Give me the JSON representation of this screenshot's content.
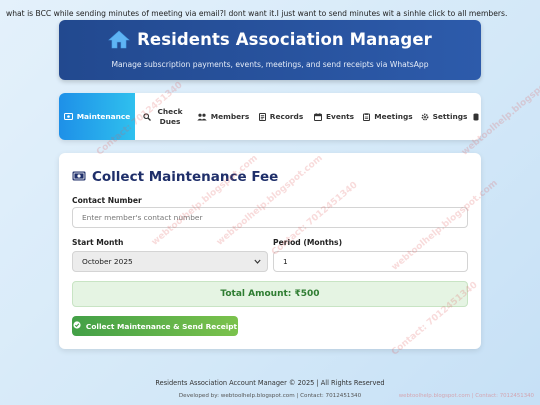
{
  "top_note": "what is BCC while sending minutes of meeting via email?I dont want it.I just want to send minutes wit a sinhle click to all members.",
  "header": {
    "title": "Residents Association Manager",
    "subtitle": "Manage subscription payments, events, meetings, and send receipts via WhatsApp",
    "icon": "home-icon"
  },
  "nav": {
    "tabs": [
      {
        "label": "Maintenance",
        "icon": "money-icon",
        "active": true
      },
      {
        "label": "Check Dues",
        "icon": "search-icon"
      },
      {
        "label": "Members",
        "icon": "users-icon"
      },
      {
        "label": "Records",
        "icon": "document-icon"
      },
      {
        "label": "Events",
        "icon": "calendar-icon"
      },
      {
        "label": "Meetings",
        "icon": "clipboard-icon"
      },
      {
        "label": "Settings",
        "icon": "gear-icon"
      }
    ]
  },
  "form": {
    "title": "Collect Maintenance Fee",
    "contact_label": "Contact Number",
    "contact_placeholder": "Enter member's contact number",
    "contact_value": "",
    "start_month_label": "Start Month",
    "start_month_value": "October 2025",
    "period_label": "Period (Months)",
    "period_value": "1",
    "total": "Total Amount: ₹500",
    "submit_label": "Collect Maintenance & Send Receipt"
  },
  "footer": {
    "line1": "Residents Association Account Manager © 2025 | All Rights Reserved",
    "line2": "Developed by: webtoolhelp.blogspot.com | Contact: 7012451340"
  },
  "watermark": {
    "site": "webtoolhelp.blogspot.com",
    "contact": "Contact: 7012451340",
    "corner": "webtoolhelp.blogspot.com | Contact: 7012451340"
  },
  "colors": {
    "header_bg": "#22498f",
    "active_tab": "#1e90e8",
    "title_color": "#1f2f6a",
    "total_text": "#2f7d32",
    "button_green": "#43a047"
  }
}
